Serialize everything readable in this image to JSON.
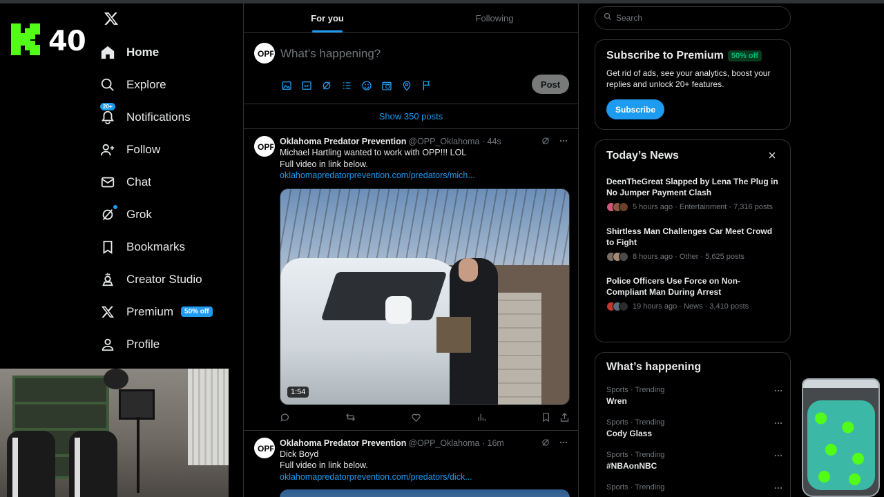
{
  "overlay": {
    "viewer_count": "40"
  },
  "nav": {
    "items": [
      {
        "label": "Home",
        "icon": "home-icon"
      },
      {
        "label": "Explore",
        "icon": "search-icon"
      },
      {
        "label": "Notifications",
        "icon": "bell-icon",
        "badge": "20+"
      },
      {
        "label": "Follow",
        "icon": "follow-icon"
      },
      {
        "label": "Chat",
        "icon": "mail-icon"
      },
      {
        "label": "Grok",
        "icon": "grok-icon"
      },
      {
        "label": "Bookmarks",
        "icon": "bookmark-icon"
      },
      {
        "label": "Creator Studio",
        "icon": "creator-studio-icon"
      },
      {
        "label": "Premium",
        "icon": "x-logo-icon",
        "pill": "50% off"
      },
      {
        "label": "Profile",
        "icon": "person-icon"
      }
    ]
  },
  "feed": {
    "tabs": [
      {
        "label": "For you"
      },
      {
        "label": "Following"
      }
    ],
    "composer": {
      "placeholder": "What’s happening?",
      "post_label": "Post"
    },
    "show_posts": "Show 350 posts",
    "tweets": [
      {
        "name": "Oklahoma Predator Prevention",
        "handle": "@OPP_Oklahoma · 44s",
        "line1": "Michael Hartling wanted to work with OPP!!! LOL",
        "line2": "Full video in link below.",
        "link": "oklahomapredatorprevention.com/predators/mich...",
        "duration": "1:54"
      },
      {
        "name": "Oklahoma Predator Prevention",
        "handle": "@OPP_Oklahoma · 16m",
        "line1": "Dick Boyd",
        "line2": "Full video in link below.",
        "link": "oklahomapredatorprevention.com/predators/dick..."
      }
    ]
  },
  "sidebar": {
    "search_placeholder": "Search",
    "premium": {
      "title": "Subscribe to Premium",
      "pill": "50% off",
      "description": "Get rid of ads, see your analytics, boost your replies and unlock 20+ features.",
      "button": "Subscribe"
    },
    "news": {
      "title": "Today’s News",
      "items": [
        {
          "headline": "DeenTheGreat Slapped by Lena The Plug in No Jumper Payment Clash",
          "meta": "5 hours ago · Entertainment · 7,316 posts"
        },
        {
          "headline": "Shirtless Man Challenges Car Meet Crowd to Fight",
          "meta": "8 hours ago · Other · 5,625 posts"
        },
        {
          "headline": "Police Officers Use Force on Non-Compliant Man During Arrest",
          "meta": "19 hours ago · News · 3,410 posts"
        }
      ]
    },
    "happening": {
      "title": "What’s happening",
      "trends": [
        {
          "meta": "Sports · Trending",
          "name": "Wren"
        },
        {
          "meta": "Sports · Trending",
          "name": "Cody Glass"
        },
        {
          "meta": "Sports · Trending",
          "name": "#NBAonNBC"
        },
        {
          "meta": "Sports · Trending",
          "name": ""
        }
      ]
    }
  },
  "colors": {
    "accent": "#1d9bf0",
    "kick_green": "#53fc18",
    "border": "#2f3336",
    "muted": "#71767b"
  }
}
